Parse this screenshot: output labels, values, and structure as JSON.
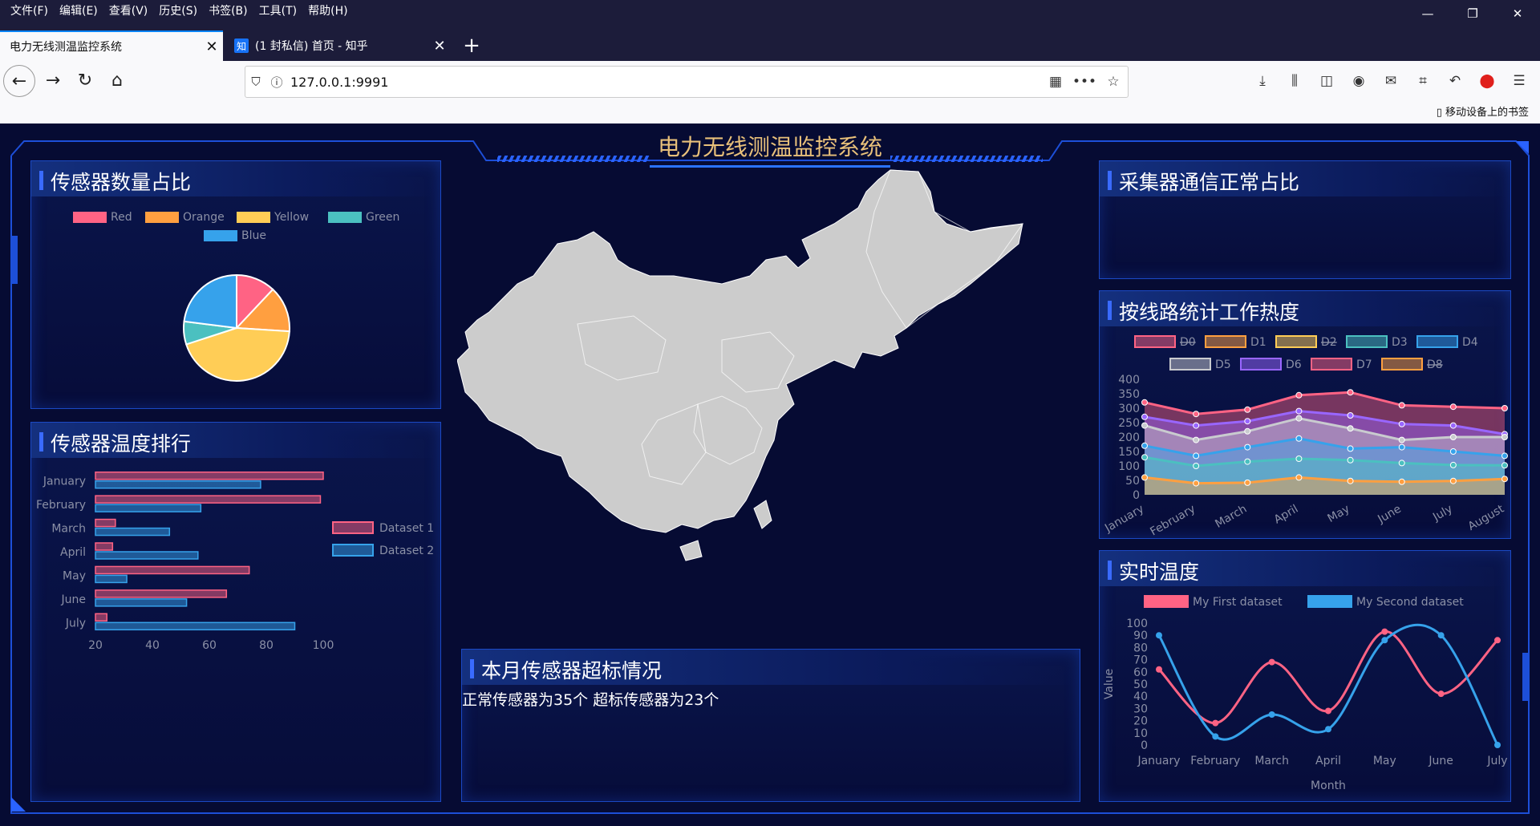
{
  "menu": [
    "文件(F)",
    "编辑(E)",
    "查看(V)",
    "历史(S)",
    "书签(B)",
    "工具(T)",
    "帮助(H)"
  ],
  "window_controls": {
    "minimize": "—",
    "restore": "❐",
    "close": "✕"
  },
  "tabs": [
    {
      "title": "电力无线测温监控系统",
      "close": "✕"
    },
    {
      "favicon": "知",
      "title": "(1 封私信) 首页 - 知乎",
      "close": "✕"
    }
  ],
  "newtab": "+",
  "nav": {
    "back": "←",
    "forward": "→",
    "reload": "↻",
    "home": "⌂"
  },
  "url": "127.0.0.1:9991",
  "bookmarks_mobile": "移动设备上的书签",
  "dashboard": {
    "title": "电力无线测温监控系统",
    "panels": {
      "sensor_ratio": "传感器数量占比",
      "sensor_temp_rank": "传感器温度排行",
      "collector_ratio": "采集器通信正常占比",
      "line_heat": "按线路统计工作热度",
      "realtime": "实时温度",
      "monthly": "本月传感器超标情况"
    },
    "monthly_summary": "正常传感器为35个 超标传感器为23个"
  },
  "chart_data": [
    {
      "type": "pie",
      "categories": [
        "Red",
        "Orange",
        "Yellow",
        "Green",
        "Blue"
      ],
      "values": [
        12,
        14,
        44,
        7,
        23
      ],
      "colors": [
        "#ff6384",
        "#ff9f40",
        "#ffcd56",
        "#4bc0c0",
        "#36a2eb"
      ]
    },
    {
      "type": "bar",
      "orientation": "horizontal",
      "categories": [
        "January",
        "February",
        "March",
        "April",
        "May",
        "June",
        "July"
      ],
      "series": [
        {
          "name": "Dataset 1",
          "values": [
            100,
            99,
            27,
            26,
            74,
            66,
            24
          ],
          "color": "#ff6384"
        },
        {
          "name": "Dataset 2",
          "values": [
            78,
            57,
            46,
            56,
            31,
            52,
            90
          ],
          "color": "#36a2eb"
        }
      ],
      "xlim": [
        20,
        100
      ],
      "xticks": [
        20,
        40,
        60,
        80,
        100
      ]
    },
    {
      "type": "area",
      "categories": [
        "January",
        "February",
        "March",
        "April",
        "May",
        "June",
        "July",
        "August"
      ],
      "ylim": [
        0,
        400
      ],
      "yticks": [
        0,
        50,
        100,
        150,
        200,
        250,
        300,
        350,
        400
      ],
      "series": [
        {
          "name": "D0",
          "hidden": true,
          "values": [
            320,
            280,
            295,
            345,
            355,
            310,
            305,
            300
          ],
          "color": "#ff6384"
        },
        {
          "name": "D1",
          "values": [
            60,
            40,
            42,
            60,
            48,
            45,
            48,
            55
          ],
          "color": "#ff9f40"
        },
        {
          "name": "D2",
          "hidden": true,
          "values": [
            135,
            105,
            125,
            145,
            130,
            120,
            115,
            115
          ],
          "color": "#ffcd56"
        },
        {
          "name": "D3",
          "values": [
            130,
            100,
            115,
            125,
            120,
            110,
            103,
            102
          ],
          "color": "#4bc0c0"
        },
        {
          "name": "D4",
          "values": [
            170,
            135,
            165,
            195,
            160,
            165,
            150,
            135
          ],
          "color": "#36a2eb"
        },
        {
          "name": "D5",
          "values": [
            240,
            190,
            220,
            265,
            230,
            190,
            200,
            200
          ],
          "color": "#c9cbcf"
        },
        {
          "name": "D6",
          "values": [
            270,
            240,
            255,
            290,
            275,
            245,
            240,
            210
          ],
          "color": "#9966ff"
        },
        {
          "name": "D7",
          "values": [
            320,
            280,
            295,
            345,
            355,
            310,
            305,
            300
          ],
          "color": "#ff6384"
        },
        {
          "name": "D8",
          "hidden": true,
          "values": [
            60,
            40,
            42,
            60,
            48,
            45,
            48,
            55
          ],
          "color": "#ff9f40"
        }
      ]
    },
    {
      "type": "line",
      "categories": [
        "January",
        "February",
        "March",
        "April",
        "May",
        "June",
        "July"
      ],
      "xlabel": "Month",
      "ylabel": "Value",
      "ylim": [
        0,
        100
      ],
      "yticks": [
        0,
        10,
        20,
        30,
        40,
        50,
        60,
        70,
        80,
        90,
        100
      ],
      "series": [
        {
          "name": "My First dataset",
          "values": [
            62,
            18,
            68,
            28,
            93,
            42,
            86
          ],
          "color": "#ff6384"
        },
        {
          "name": "My Second dataset",
          "values": [
            90,
            7,
            25,
            13,
            86,
            90,
            0
          ],
          "color": "#36a2eb"
        }
      ]
    }
  ]
}
